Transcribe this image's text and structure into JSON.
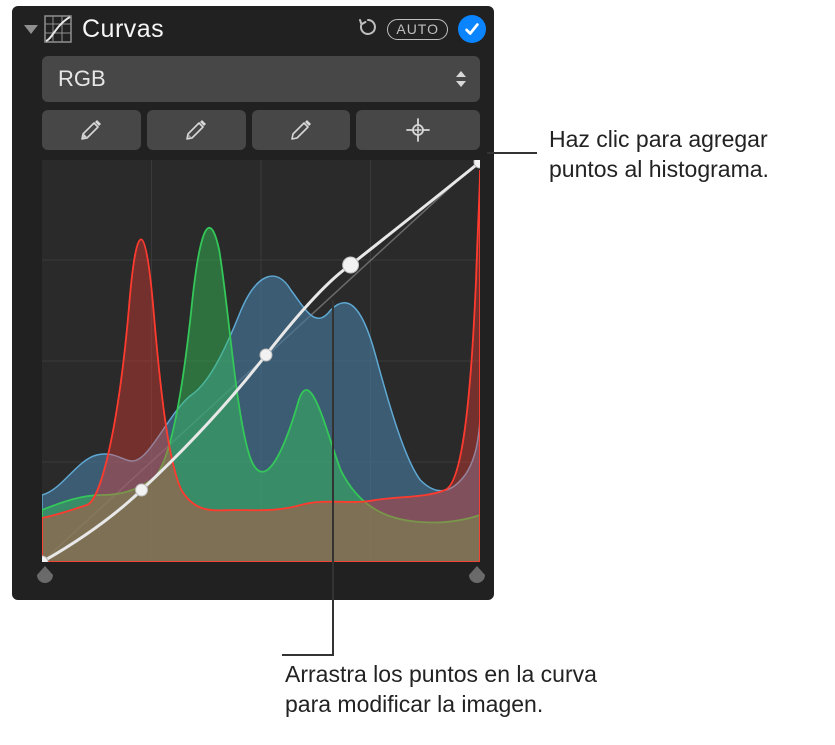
{
  "panel": {
    "title": "Curvas",
    "auto_label": "AUTO",
    "channel_label": "RGB"
  },
  "callouts": {
    "add_point": "Haz clic para agregar\npuntos al histograma.",
    "drag_point": "Arrastra los puntos en la curva\npara modificar la imagen."
  },
  "colors": {
    "accent": "#0a84ff",
    "panel_bg": "#212121",
    "btn_bg": "#474747",
    "red": "#ff3b2f",
    "green": "#34c759",
    "blue": "#3a7ca5"
  }
}
